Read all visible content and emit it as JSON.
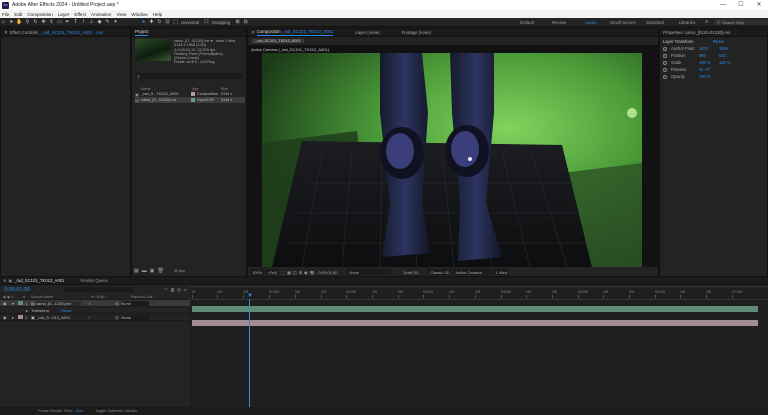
{
  "titlebar": {
    "app_icon": "Ae",
    "title": "Adobe After Effects 2024 - Untitled Project.aep *",
    "minimize": "—",
    "maximize": "☐",
    "close": "✕"
  },
  "menu": [
    "File",
    "Edit",
    "Composition",
    "Layer",
    "Effect",
    "Animation",
    "View",
    "Window",
    "Help"
  ],
  "toolbar": {
    "universal": "Universal",
    "snapping": "Snapping",
    "workspaces": [
      "Default",
      "Review",
      "Learn",
      "Small Screen",
      "Standard",
      "Libraries"
    ],
    "active_workspace": "Learn",
    "search_placeholder": "Search Help"
  },
  "effect_controls": {
    "tab_label": "Effect Controls",
    "layer": "_rad_SC101_TK013_A001 · camo_[0101-01230].exr"
  },
  "project": {
    "tab_label": "Project",
    "info": [
      "camo_[0...01230].exr ▾ , used 1 time",
      "3144 x 1968 (1.00)",
      "Δ 0;00;51;12, 23.976 fps",
      "Floating Point (Premultiplied)",
      "(Scene-Linear)",
      "",
      "Profile: ACES - ACEScg"
    ],
    "columns": {
      "name": "Name",
      "type": "Type",
      "size": "Size"
    },
    "items": [
      {
        "name": "_rad_S...TK013_A001",
        "type": "Composition",
        "size": "3144 x"
      },
      {
        "name": "camo_[0...01230].exr",
        "type": "OpenEXR",
        "size": "3144 x"
      }
    ],
    "bpc": "32 bpc"
  },
  "composition": {
    "tab_label": "Composition",
    "comp_name": "_rad_SC101_TK013_A001",
    "layer_tab": "Layer (none)",
    "footage_tab": "Footage (none)",
    "subtab": "_rad_SC101_TK013_A001",
    "camera_label": "Active Camera (_rad_SC101_TK013_A001)",
    "zoom": "100%",
    "resolution": "(Full)",
    "timecode": "0;00;01;00",
    "channel": "None",
    "renderer": "Classic 3D",
    "view": "Active Camera",
    "views": "1 View",
    "draft": "Draft 3D"
  },
  "properties": {
    "tab_label": "Properties: camo_[0101-01230].exr",
    "group": "Layer Transform",
    "reset": "Reset",
    "rows": [
      {
        "name": "Anchor Point",
        "v1": "1572",
        "v2": "1984"
      },
      {
        "name": "Position",
        "v1": "960",
        "v2": "540"
      },
      {
        "name": "Scale",
        "v1": "100 %",
        "v2": "100 %"
      },
      {
        "name": "Rotation",
        "v1": "0x +0°",
        "v2": ""
      },
      {
        "name": "Opacity",
        "v1": "100 %",
        "v2": ""
      }
    ]
  },
  "timeline": {
    "tab_label": "_rad_SC101_TK013_A001",
    "render_queue": "Render Queue",
    "timecode": "0;00;01;00",
    "columns": {
      "source": "Source Name",
      "parent": "Parent & Link"
    },
    "ruler": [
      "0f",
      "10f",
      "20f",
      "01:00f",
      "10f",
      "20f",
      "02:00f",
      "10f",
      "20f",
      "03:00f",
      "10f",
      "20f",
      "04:00f",
      "10f",
      "20f",
      "05:00f",
      "10f",
      "20f",
      "06:00f",
      "10f",
      "20f",
      "07:00f"
    ],
    "layers": [
      {
        "num": "1",
        "name": "camo_[0...1230].exr",
        "parent": "None"
      },
      {
        "num": "2",
        "name": "_rad_S...013_A001",
        "parent": "None"
      }
    ],
    "transform_label": "Transform",
    "reset": "Reset"
  },
  "status": {
    "render_label": "Frame Render Time:",
    "render_value": "0ms",
    "toggle": "Toggle Switches / Modes"
  },
  "colors": {
    "accent": "#2d8ceb",
    "layer1_bar": "#5f8d75",
    "layer2_bar": "#a38d93"
  }
}
